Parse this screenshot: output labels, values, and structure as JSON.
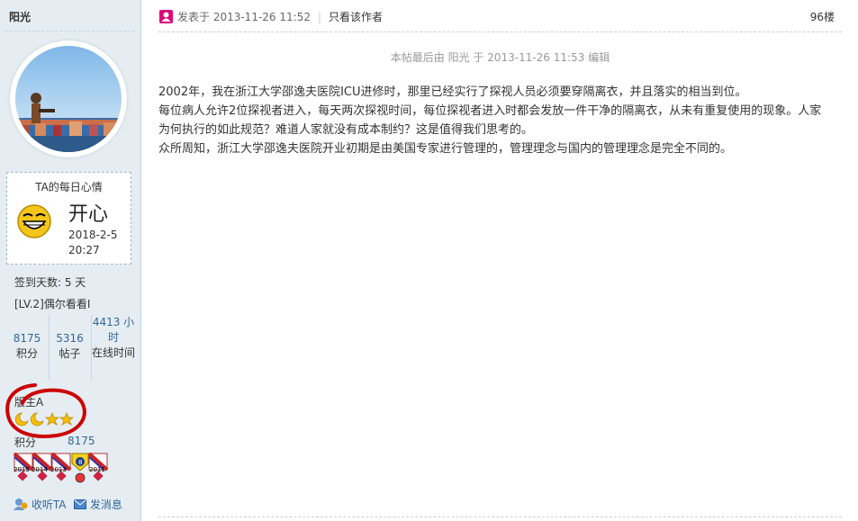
{
  "user": {
    "name": "阳光",
    "mood_title": "TA的每日心情",
    "mood": "开心",
    "mood_date": "2018-2-5 20:27",
    "sign_days": "签到天数: 5 天",
    "level": "[LV.2]偶尔看看I",
    "stats": [
      {
        "value": "8175",
        "label": "积分"
      },
      {
        "value": "5316",
        "label": "帖子"
      },
      {
        "value": "4413 小时",
        "label": "在线时间"
      }
    ],
    "group": "版主A",
    "points_label": "积分",
    "points_value": "8175",
    "medal_labels": [
      "2015",
      "2014",
      "2013",
      "2011"
    ],
    "medal_center": "8",
    "listen_label": "收听TA",
    "message_label": "发消息"
  },
  "post": {
    "posted_label": "发表于 2013-11-26 11:52",
    "separator": "|",
    "only_author": "只看该作者",
    "floor": "96楼",
    "edit_note": "本帖最后由 阳光 于 2013-11-26 11:53 编辑",
    "paragraphs": [
      "2002年，我在浙江大学邵逸夫医院ICU进修时，那里已经实行了探视人员必须要穿隔离衣，并且落实的相当到位。",
      "每位病人允许2位探视者进入，每天两次探视时间，每位探视者进入时都会发放一件干净的隔离衣，从未有重复使用的现象。人家为何执行的如此规范？难道人家就没有成本制约？这是值得我们思考的。",
      "众所周知，浙江大学邵逸夫医院开业初期是由美国专家进行管理的，管理理念与国内的管理理念是完全不同的。"
    ]
  },
  "colors": {
    "sidebar_bg": "#e5edf2",
    "link": "#336699",
    "author_icon": "#e0007a",
    "annotation_red": "#cc0000"
  }
}
